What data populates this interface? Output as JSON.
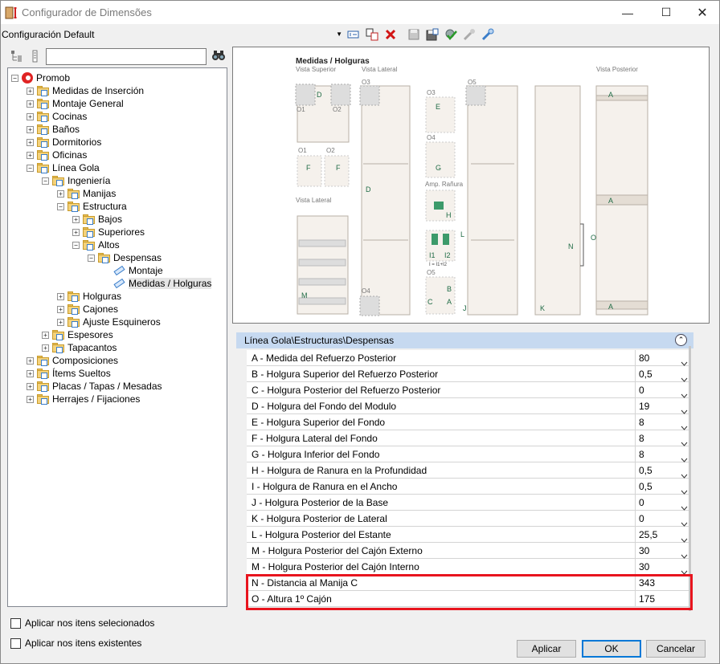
{
  "window": {
    "title": "Configurador de Dimensões"
  },
  "toolbar": {
    "config_value": "Configuración Default"
  },
  "tree": {
    "nodes": [
      {
        "label": "Promob"
      },
      {
        "label": "Medidas de Inserción"
      },
      {
        "label": "Montaje General"
      },
      {
        "label": "Cocinas"
      },
      {
        "label": "Baños"
      },
      {
        "label": "Dormitorios"
      },
      {
        "label": "Oficinas"
      },
      {
        "label": "Línea Gola"
      },
      {
        "label": "Ingeniería"
      },
      {
        "label": "Manijas"
      },
      {
        "label": "Estructura"
      },
      {
        "label": "Bajos"
      },
      {
        "label": "Superiores"
      },
      {
        "label": "Altos"
      },
      {
        "label": "Despensas"
      },
      {
        "label": "Montaje"
      },
      {
        "label": "Medidas / Holguras"
      },
      {
        "label": "Holguras"
      },
      {
        "label": "Cajones"
      },
      {
        "label": "Ajuste Esquineros"
      },
      {
        "label": "Espesores"
      },
      {
        "label": "Tapacantos"
      },
      {
        "label": "Composiciones"
      },
      {
        "label": "Ítems Sueltos"
      },
      {
        "label": "Placas / Tapas / Mesadas"
      },
      {
        "label": "Herrajes / Fijaciones"
      }
    ]
  },
  "options": {
    "apply_selected": "Aplicar nos itens selecionados",
    "apply_existing": "Aplicar nos itens existentes"
  },
  "diagram": {
    "title": "Medidas / Holguras",
    "vista_superior": "Vista Superior",
    "vista_lateral_top": "Vista Lateral",
    "vista_lateral_bottom": "Vista Lateral",
    "vista_posterior": "Vista Posterior",
    "amp_ranura": "Amp. Rañura",
    "formula": "I = I1+I2",
    "o1": "O1",
    "o2": "O2",
    "o3": "O3",
    "o4": "O4",
    "o5": "O5",
    "letters": {
      "A": "A",
      "B": "B",
      "C": "C",
      "D": "D",
      "E": "E",
      "F": "F",
      "G": "G",
      "H": "H",
      "I1": "I1",
      "I2": "I2",
      "J": "J",
      "K": "K",
      "L": "L",
      "M": "M",
      "N": "N",
      "O": "O"
    }
  },
  "props": {
    "path": "Línea Gola\\Estructuras\\Despensas",
    "rows": [
      {
        "name": "A - Medida del Refuerzo Posterior",
        "value": "80"
      },
      {
        "name": "B - Holgura Superior del Refuerzo Posterior",
        "value": "0,5"
      },
      {
        "name": "C - Holgura Posterior del Refuerzo Posterior",
        "value": "0"
      },
      {
        "name": "D - Holgura del Fondo del Modulo",
        "value": "19"
      },
      {
        "name": "E - Holgura Superior del Fondo",
        "value": "8"
      },
      {
        "name": "F - Holgura Lateral del Fondo",
        "value": "8"
      },
      {
        "name": "G - Holgura Inferior del Fondo",
        "value": "8"
      },
      {
        "name": "H - Holgura de Ranura en la Profundidad",
        "value": "0,5"
      },
      {
        "name": "I - Holgura de Ranura en el Ancho",
        "value": "0,5"
      },
      {
        "name": "J - Holgura Posterior de la Base",
        "value": "0"
      },
      {
        "name": "K - Holgura Posterior de Lateral",
        "value": "0"
      },
      {
        "name": "L - Holgura Posterior del Estante",
        "value": "25,5"
      },
      {
        "name": "M - Holgura Posterior del Cajón Externo",
        "value": "30"
      },
      {
        "name": "M - Holgura Posterior del Cajón Interno",
        "value": "30"
      },
      {
        "name": "N - Distancia al Manija C",
        "value": "343"
      },
      {
        "name": "O - Altura 1º Cajón",
        "value": "175"
      }
    ]
  },
  "buttons": {
    "apply": "Aplicar",
    "ok": "OK",
    "cancel": "Cancelar"
  },
  "colors": {
    "highlight": "#e8141e",
    "header": "#c6d9f0",
    "accent": "#0078d7"
  }
}
